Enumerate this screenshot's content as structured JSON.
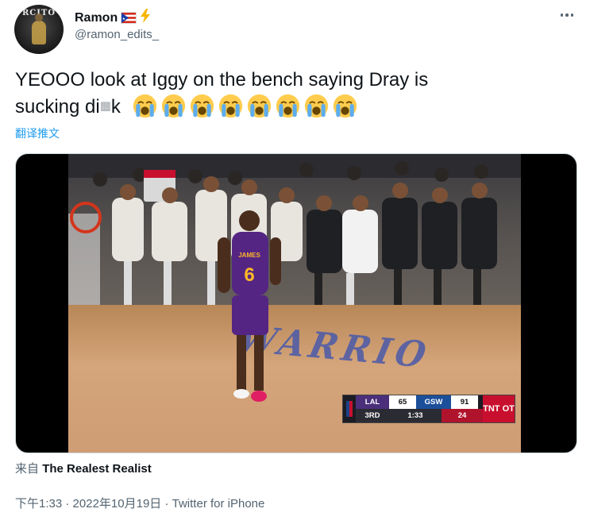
{
  "author": {
    "display_name": "Ramon",
    "handle": "@ramon_edits_",
    "avatar_text": "RCITO",
    "name_badges": [
      "puerto-rico-flag-icon",
      "high-voltage-icon"
    ]
  },
  "tweet": {
    "text": "YEOOO look at Iggy on the bench saying Dray is sucking di🀫k",
    "text_line_1": "YEOOO look at Iggy on the bench saying Dray is",
    "text_line_2": "sucking di",
    "censor_glyph": "▦",
    "text_line_2_end": "k",
    "emoji": [
      "loudly-crying-face",
      "loudly-crying-face",
      "loudly-crying-face",
      "loudly-crying-face",
      "loudly-crying-face",
      "loudly-crying-face",
      "loudly-crying-face",
      "loudly-crying-face"
    ],
    "translate_label": "翻译推文"
  },
  "media": {
    "floor_text": "WARRIO",
    "jersey_name": "JAMES",
    "jersey_number": "6",
    "scorebug": {
      "team_left": "LAL",
      "score_left": "65",
      "team_right": "GSW",
      "score_right": "91",
      "quarter": "3RD",
      "clock": "1:33",
      "shot_clock": "24",
      "network": "TNT OT"
    }
  },
  "source": {
    "prefix": "来自",
    "name": "The Realest Realist"
  },
  "meta": {
    "time": "下午1:33",
    "separator": " · ",
    "date": "2022年10月19日",
    "client": "Twitter for iPhone"
  },
  "colors": {
    "link": "#1d9bf0",
    "secondary_text": "#536471",
    "primary_text": "#0f1419"
  }
}
